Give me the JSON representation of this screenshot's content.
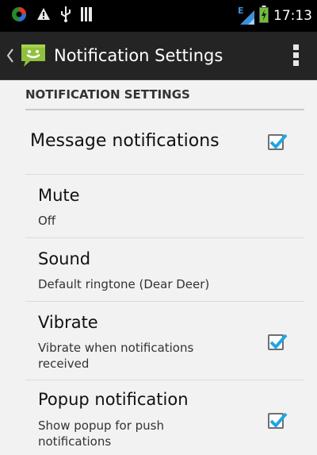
{
  "status_bar": {
    "time": "17:13",
    "network_label": "E",
    "icons": [
      "app-notification-icon",
      "warning-icon",
      "usb-icon",
      "storage-icon",
      "signal-icon",
      "battery-icon"
    ]
  },
  "action_bar": {
    "title": "Notification Settings",
    "icons": [
      "back-caret-icon",
      "messaging-app-icon",
      "overflow-menu-icon"
    ]
  },
  "section": {
    "header": "NOTIFICATION SETTINGS"
  },
  "preferences": [
    {
      "title": "Message notifications",
      "summary": "",
      "checkbox": true,
      "checked": true
    },
    {
      "title": "Mute",
      "summary": "Off",
      "checkbox": false,
      "checked": false
    },
    {
      "title": "Sound",
      "summary": "Default ringtone (Dear Deer)",
      "checkbox": false,
      "checked": false
    },
    {
      "title": "Vibrate",
      "summary": "Vibrate when notifications received",
      "checkbox": true,
      "checked": true
    },
    {
      "title": "Popup notification",
      "summary": "Show popup for push notifications",
      "checkbox": true,
      "checked": true
    }
  ],
  "colors": {
    "accent_check": "#1ea7e1",
    "app_icon_green": "#8fc13c",
    "battery_green": "#6fbf3a"
  }
}
